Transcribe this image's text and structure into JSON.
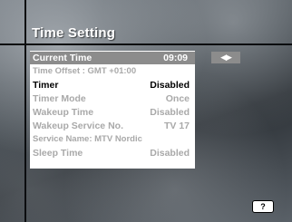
{
  "screen": {
    "title": "Time Setting"
  },
  "menu": {
    "rows": [
      {
        "label": "Current Time",
        "value": "09:09"
      },
      {
        "label": "Time Offset : GMT +01:00",
        "value": ""
      },
      {
        "label": "Timer",
        "value": "Disabled"
      },
      {
        "label": "Timer Mode",
        "value": "Once"
      },
      {
        "label": "Wakeup Time",
        "value": "Disabled"
      },
      {
        "label": "Wakeup Service No.",
        "value": "TV 17"
      },
      {
        "label": "Service Name: MTV Nordic",
        "value": ""
      },
      {
        "label": "Sleep Time",
        "value": "Disabled"
      }
    ]
  },
  "nav": {
    "arrows": "◀▶"
  },
  "help": {
    "label": "?"
  },
  "colors": {
    "highlight": "#8c8c8c",
    "panel": "#ffffff",
    "dim_text": "#a9a9a9"
  }
}
